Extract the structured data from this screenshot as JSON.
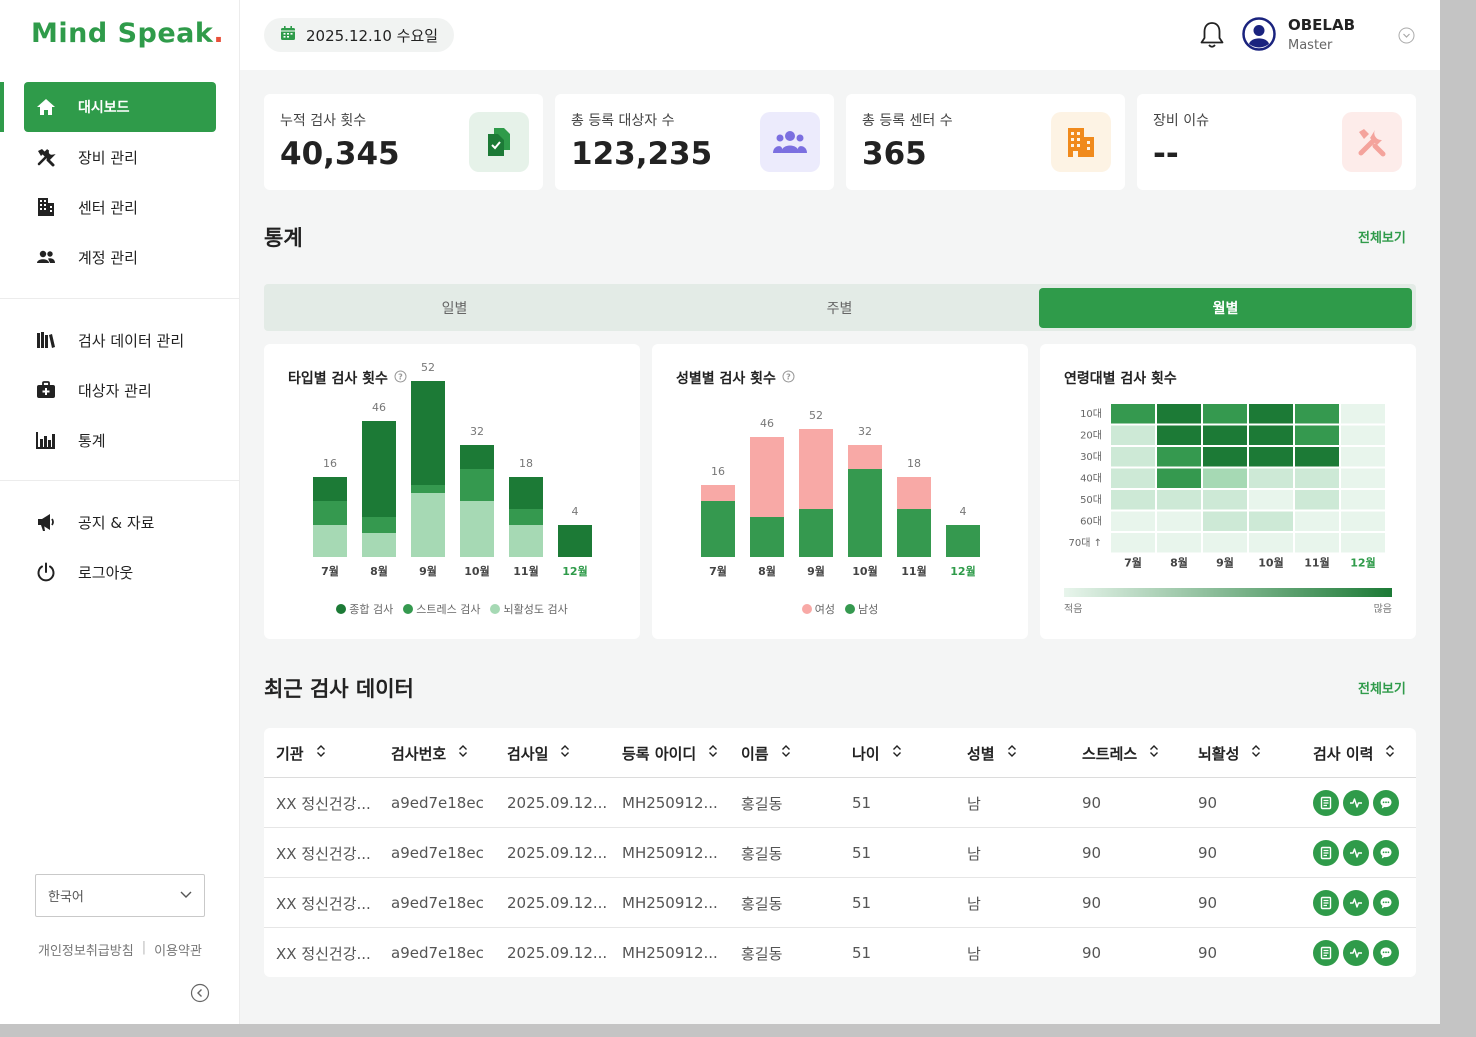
{
  "brand": {
    "name_main": "Mind Speak",
    "name_dot": "."
  },
  "nav": {
    "items": [
      {
        "label": "대시보드"
      },
      {
        "label": "장비 관리"
      },
      {
        "label": "센터 관리"
      },
      {
        "label": "계정 관리"
      },
      {
        "label": "검사 데이터 관리"
      },
      {
        "label": "대상자 관리"
      },
      {
        "label": "통계"
      },
      {
        "label": "공지 & 자료"
      },
      {
        "label": "로그아웃"
      }
    ]
  },
  "language": {
    "selected": "한국어"
  },
  "footer": {
    "privacy": "개인정보취급방침",
    "separator": "|",
    "terms": "이용약관"
  },
  "header": {
    "date": "2025.12.10 수요일",
    "user_name": "OBELAB",
    "user_role": "Master"
  },
  "summary_cards": [
    {
      "label": "누적 검사 횟수",
      "value": "40,345",
      "icon": "documents-icon",
      "color": "#2f9b4a",
      "bg": "#e6f2e9"
    },
    {
      "label": "총 등록 대상자 수",
      "value": "123,235",
      "icon": "users-icon",
      "color": "#7b6fe0",
      "bg": "#ecebfc"
    },
    {
      "label": "총 등록 센터 수",
      "value": "365",
      "icon": "building-icon",
      "color": "#f08a1c",
      "bg": "#fdf3e4"
    },
    {
      "label": "장비 이슈",
      "value": "--",
      "icon": "tools-icon",
      "color": "#f4a39c",
      "bg": "#fdecea"
    }
  ],
  "stats": {
    "title": "통계",
    "view_all": "전체보기",
    "tabs": [
      {
        "label": "일별"
      },
      {
        "label": "주별"
      },
      {
        "label": "월별"
      }
    ],
    "active_tab": "월별"
  },
  "colors": {
    "accent": "#2f9b4a",
    "dark_green": "#1c7a36",
    "light_green": "#a6d9b4",
    "pink": "#f8a9a6"
  },
  "chart_data": [
    {
      "type": "bar",
      "title": "타입별 검사 횟수",
      "stacked": true,
      "categories": [
        "7월",
        "8월",
        "9월",
        "10월",
        "11월",
        "12월"
      ],
      "highlight_category": "12월",
      "totals": [
        16,
        46,
        52,
        32,
        18,
        4
      ],
      "series": [
        {
          "name": "종합 검사",
          "color": "#1c7a36",
          "values": [
            3,
            12,
            13,
            3,
            4,
            4
          ]
        },
        {
          "name": "스트레스 검사",
          "color": "#35994f",
          "values": [
            3,
            2,
            1,
            4,
            2,
            0
          ]
        },
        {
          "name": "뇌활성도 검사",
          "color": "#a6d9b4",
          "values": [
            4,
            3,
            8,
            7,
            4,
            0
          ]
        }
      ]
    },
    {
      "type": "bar",
      "title": "성별별 검사 횟수",
      "stacked": true,
      "categories": [
        "7월",
        "8월",
        "9월",
        "10월",
        "11월",
        "12월"
      ],
      "highlight_category": "12월",
      "totals": [
        16,
        46,
        52,
        32,
        18,
        4
      ],
      "series": [
        {
          "name": "여성",
          "color": "#f8a9a6",
          "values": [
            2,
            10,
            10,
            3,
            4,
            0
          ]
        },
        {
          "name": "남성",
          "color": "#35994f",
          "values": [
            7,
            5,
            6,
            11,
            6,
            4
          ]
        }
      ]
    },
    {
      "type": "heatmap",
      "title": "연령대별 검사 횟수",
      "x": [
        "7월",
        "8월",
        "9월",
        "10월",
        "11월",
        "12월"
      ],
      "y": [
        "10대",
        "20대",
        "30대",
        "40대",
        "50대",
        "60대",
        "70대 ↑"
      ],
      "highlight_category": "12월",
      "values": [
        [
          3,
          4,
          3,
          4,
          3,
          0
        ],
        [
          1,
          4,
          4,
          4,
          3,
          0
        ],
        [
          1,
          3,
          4,
          4,
          4,
          0
        ],
        [
          1,
          3,
          2,
          1,
          1,
          0
        ],
        [
          1,
          1,
          1,
          0,
          1,
          0
        ],
        [
          0,
          0,
          1,
          1,
          0,
          0
        ],
        [
          0,
          0,
          0,
          0,
          0,
          0
        ]
      ],
      "scale_min_label": "적음",
      "scale_max_label": "많음"
    }
  ],
  "recent": {
    "title": "최근 검사 데이터",
    "view_all": "전체보기",
    "columns": [
      "기관",
      "검사번호",
      "검사일",
      "등록 아이디",
      "이름",
      "나이",
      "성별",
      "스트레스",
      "뇌활성",
      "검사 이력"
    ],
    "rows": [
      [
        "XX 정신건강...",
        "a9ed7e18ec",
        "2025.09.12...",
        "MH250912...",
        "홍길동",
        "51",
        "남",
        "90",
        "90"
      ],
      [
        "XX 정신건강...",
        "a9ed7e18ec",
        "2025.09.12...",
        "MH250912...",
        "홍길동",
        "51",
        "남",
        "90",
        "90"
      ],
      [
        "XX 정신건강...",
        "a9ed7e18ec",
        "2025.09.12...",
        "MH250912...",
        "홍길동",
        "51",
        "남",
        "90",
        "90"
      ],
      [
        "XX 정신건강...",
        "a9ed7e18ec",
        "2025.09.12...",
        "MH250912...",
        "홍길동",
        "51",
        "남",
        "90",
        "90"
      ]
    ],
    "row_actions": [
      "report-icon",
      "waveform-icon",
      "chat-icon"
    ]
  }
}
